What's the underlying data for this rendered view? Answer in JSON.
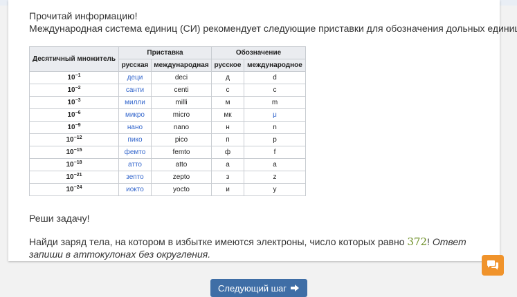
{
  "intro": {
    "line1": "Прочитай информацию!",
    "line2": "Международная система единиц (СИ) рекомендует следующие приставки для обозначения дольных единиц:"
  },
  "table": {
    "header_multiplier": "Десятичный множитель",
    "header_prefix": "Приставка",
    "header_symbol": "Обозначение",
    "sub_russian": "русская",
    "sub_international": "международная",
    "sub_russian_symbol": "русское",
    "sub_international_symbol": "международное",
    "rows": [
      {
        "base": "10",
        "exp": "−1",
        "ru": "деци",
        "intl": "deci",
        "ru_sym": "д",
        "intl_sym": "d"
      },
      {
        "base": "10",
        "exp": "−2",
        "ru": "санти",
        "intl": "centi",
        "ru_sym": "с",
        "intl_sym": "c"
      },
      {
        "base": "10",
        "exp": "−3",
        "ru": "милли",
        "intl": "milli",
        "ru_sym": "м",
        "intl_sym": "m"
      },
      {
        "base": "10",
        "exp": "−6",
        "ru": "микро",
        "intl": "micro",
        "ru_sym": "мк",
        "intl_sym": "μ"
      },
      {
        "base": "10",
        "exp": "−9",
        "ru": "нано",
        "intl": "nano",
        "ru_sym": "н",
        "intl_sym": "n"
      },
      {
        "base": "10",
        "exp": "−12",
        "ru": "пико",
        "intl": "pico",
        "ru_sym": "п",
        "intl_sym": "p"
      },
      {
        "base": "10",
        "exp": "−15",
        "ru": "фемто",
        "intl": "femto",
        "ru_sym": "ф",
        "intl_sym": "f"
      },
      {
        "base": "10",
        "exp": "−18",
        "ru": "атто",
        "intl": "atto",
        "ru_sym": "а",
        "intl_sym": "a"
      },
      {
        "base": "10",
        "exp": "−21",
        "ru": "зепто",
        "intl": "zepto",
        "ru_sym": "з",
        "intl_sym": "z"
      },
      {
        "base": "10",
        "exp": "−24",
        "ru": "иокто",
        "intl": "yocto",
        "ru_sym": "и",
        "intl_sym": "y"
      }
    ]
  },
  "task": {
    "heading": "Реши задачу!",
    "text": "Найди заряд тела, на котором в избытке имеются электроны, число которых равно",
    "number": "372",
    "exclaim": "!",
    "instruction": "Ответ запиши в аттокулонах без округления."
  },
  "buttons": {
    "next_label": "Следующий шаг",
    "chat_icon": "chat-icon"
  },
  "colors": {
    "link": "#3366cc",
    "number": "#6b8e23",
    "chat_button": "#f0932b",
    "next_button": "#3f6ea6"
  }
}
